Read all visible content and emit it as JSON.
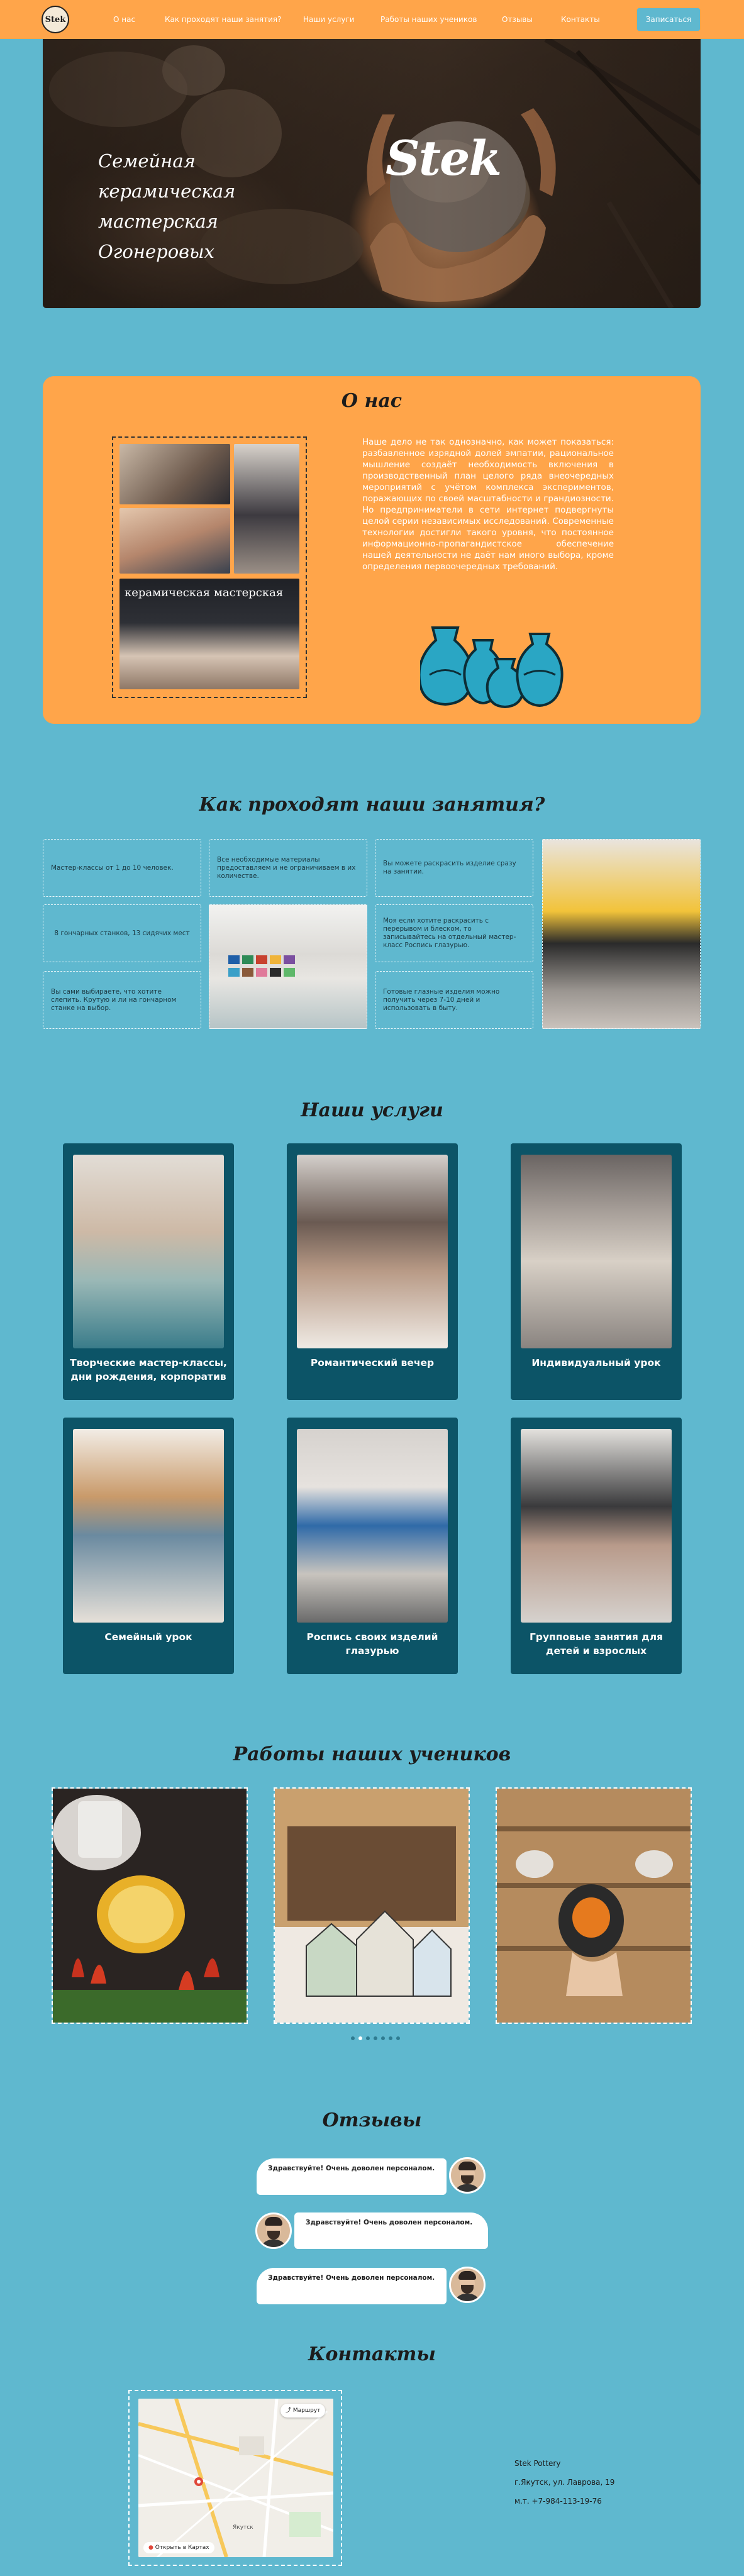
{
  "header": {
    "logo_text": "Stek",
    "nav": [
      "О нас",
      "Как проходят наши занятия?",
      "Наши услуги",
      "Работы наших учеников",
      "Отзывы",
      "Контакты"
    ],
    "signup_label": "Записаться"
  },
  "hero": {
    "title": "Семейная керамическая мастерская Огонеровых",
    "brand": "Stek"
  },
  "about": {
    "title": "О нас",
    "text": "Наше дело не так однозначно, как может показаться: разбавленное изрядной долей эмпатии, рациональное мышление создаёт необходимость включения в производственный план целого ряда внеочередных мероприятий с учётом комплекса экспериментов, поражающих по своей масштабности и грандиозности. Но предприниматели в сети интернет подвергнуты целой серии независимых исследований. Современные технологии достигли такого уровня, что постоянное информационно-пропагандистское обеспечение нашей деятельности не даёт нам иного выбора, кроме определения первоочередных требований.",
    "banner_text": "керамическая мастерская"
  },
  "process": {
    "title": "Как проходят наши занятия?",
    "cells": [
      "Мастер-классы от 1 до 10 человек.",
      "Все необходимые материалы предоставляем и не ограничиваем в их количестве.",
      "Вы можете раскрасить изделие сразу на занятии.",
      "8 гончарных станков, 13 сидячих мест",
      "Моя если хотите раскрасить с перерывом и блеском, то записывайтесь на отдельный мастер-класс Роспись глазурью.",
      "Вы сами выбираете, что хотите слепить. Крутую и ли на гончарном станке на выбор.",
      "Готовые глазные изделия можно получить через 7-10 дней и использовать в быту."
    ]
  },
  "services": {
    "title": "Наши услуги",
    "items": [
      "Творческие мастер-классы, дни рождения, корпоратив",
      "Романтический вечер",
      "Индивидуальный урок",
      "Семейный урок",
      "Роспись своих изделий глазурью",
      "Групповые занятия для детей и взрослых"
    ]
  },
  "works": {
    "title": "Работы наших учеников",
    "slides_count": 7,
    "active_slide": 1
  },
  "reviews": {
    "title": "Отзывы",
    "items": [
      "Здравствуйте! Очень доволен персоналом.",
      "Здравствуйте! Очень доволен персоналом.",
      "Здравствуйте! Очень доволен персоналом."
    ]
  },
  "contacts": {
    "title": "Контакты",
    "name": "Stek Pottery",
    "address": "г.Якутск, ул. Лаврова, 19",
    "phone": "м.т. +7-984-113-19-76",
    "map_route_label": "Маршрут",
    "map_footer": "Открыть в Картах",
    "map_place": "Якутск"
  },
  "colors": {
    "background": "#5fb8cf",
    "orange": "#ffa54a",
    "card": "#0c5467"
  }
}
